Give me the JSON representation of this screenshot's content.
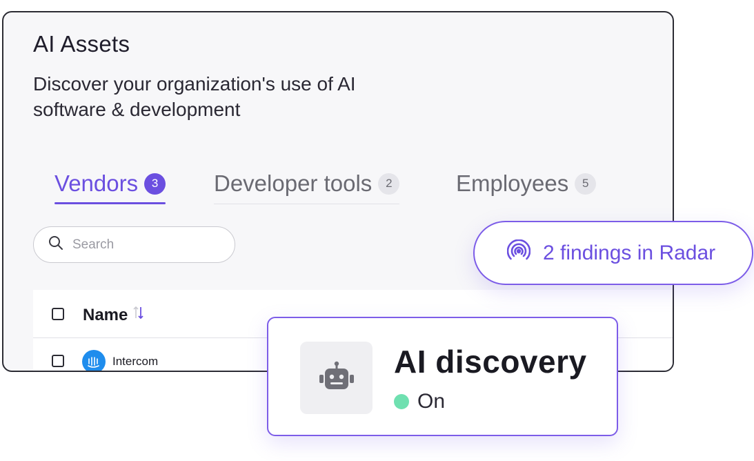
{
  "assets_panel": {
    "title": "AI Assets",
    "subtitle": "Discover your organization's use of AI software & development",
    "tabs": [
      {
        "label": "Vendors",
        "count": "3",
        "active": true
      },
      {
        "label": "Developer tools",
        "count": "2",
        "active": false
      },
      {
        "label": "Employees",
        "count": "5",
        "active": false
      }
    ],
    "search": {
      "placeholder": "Search",
      "value": "",
      "icon": "search-icon"
    },
    "table": {
      "columns": [
        {
          "label": "Name",
          "sort_icon": "sort-icon"
        }
      ],
      "rows": [
        {
          "name": "Intercom",
          "logo_icon": "intercom-logo-icon"
        }
      ]
    }
  },
  "radar_pill": {
    "text": "2 findings in Radar",
    "icon": "radar-icon"
  },
  "discovery_card": {
    "title": "AI discovery",
    "status": "On",
    "status_color": "#6fe0b0",
    "icon": "robot-icon"
  },
  "colors": {
    "accent": "#6b4fe0",
    "panel_bg": "#f7f7f9",
    "border": "#2b2b33"
  }
}
